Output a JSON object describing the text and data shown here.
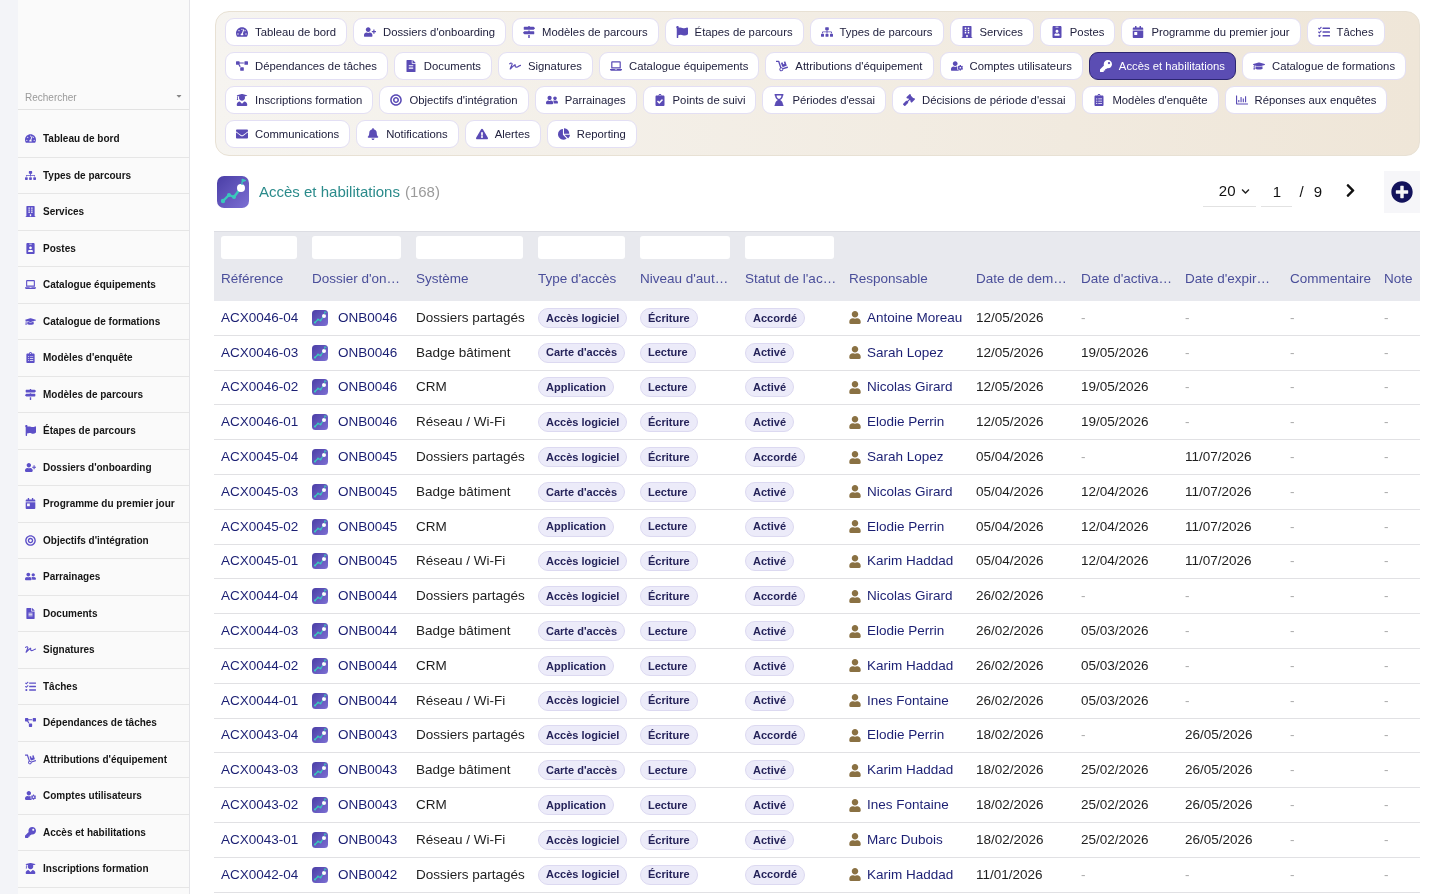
{
  "sidebar": {
    "search": {
      "placeholder": "Rechercher"
    },
    "items": [
      {
        "label": "Tableau de bord"
      },
      {
        "label": "Types de parcours"
      },
      {
        "label": "Services"
      },
      {
        "label": "Postes"
      },
      {
        "label": "Catalogue équipements"
      },
      {
        "label": "Catalogue de formations"
      },
      {
        "label": "Modèles d'enquête"
      },
      {
        "label": "Modèles de parcours"
      },
      {
        "label": "Étapes de parcours"
      },
      {
        "label": "Dossiers d'onboarding"
      },
      {
        "label": "Programme du premier jour"
      },
      {
        "label": "Objectifs d'intégration"
      },
      {
        "label": "Parrainages"
      },
      {
        "label": "Documents"
      },
      {
        "label": "Signatures"
      },
      {
        "label": "Tâches"
      },
      {
        "label": "Dépendances de tâches"
      },
      {
        "label": "Attributions d'équipement"
      },
      {
        "label": "Comptes utilisateurs"
      },
      {
        "label": "Accès et habilitations"
      },
      {
        "label": "Inscriptions formation"
      }
    ]
  },
  "nav_tabs": [
    {
      "label": "Tableau de bord",
      "selected": false
    },
    {
      "label": "Dossiers d'onboarding",
      "selected": false
    },
    {
      "label": "Modèles de parcours",
      "selected": false
    },
    {
      "label": "Étapes de parcours",
      "selected": false
    },
    {
      "label": "Types de parcours",
      "selected": false
    },
    {
      "label": "Services",
      "selected": false
    },
    {
      "label": "Postes",
      "selected": false
    },
    {
      "label": "Programme du premier jour",
      "selected": false
    },
    {
      "label": "Tâches",
      "selected": false
    },
    {
      "label": "Dépendances de tâches",
      "selected": false
    },
    {
      "label": "Documents",
      "selected": false
    },
    {
      "label": "Signatures",
      "selected": false
    },
    {
      "label": "Catalogue équipements",
      "selected": false
    },
    {
      "label": "Attributions d'équipement",
      "selected": false
    },
    {
      "label": "Comptes utilisateurs",
      "selected": false
    },
    {
      "label": "Accès et habilitations",
      "selected": true
    },
    {
      "label": "Catalogue de formations",
      "selected": false
    },
    {
      "label": "Inscriptions formation",
      "selected": false
    },
    {
      "label": "Objectifs d'intégration",
      "selected": false
    },
    {
      "label": "Parrainages",
      "selected": false
    },
    {
      "label": "Points de suivi",
      "selected": false
    },
    {
      "label": "Périodes d'essai",
      "selected": false
    },
    {
      "label": "Décisions de période d'essai",
      "selected": false
    },
    {
      "label": "Modèles d'enquête",
      "selected": false
    },
    {
      "label": "Réponses aux enquêtes",
      "selected": false
    },
    {
      "label": "Communications",
      "selected": false
    },
    {
      "label": "Notifications",
      "selected": false
    },
    {
      "label": "Alertes",
      "selected": false
    },
    {
      "label": "Reporting",
      "selected": false
    }
  ],
  "header": {
    "title": "Accès et habilitations",
    "count": "(168)"
  },
  "pagination": {
    "page_size": "20",
    "page": "1",
    "separator": "/",
    "total_pages": "9"
  },
  "table": {
    "columns": [
      {
        "label": "Référence",
        "kind": "link",
        "filter": true
      },
      {
        "label": "Dossier d'on…",
        "kind": "dossier",
        "filter": true
      },
      {
        "label": "Système",
        "kind": "text",
        "filter": true
      },
      {
        "label": "Type d'accès",
        "kind": "badge",
        "filter": true
      },
      {
        "label": "Niveau d'aut…",
        "kind": "badge",
        "filter": true
      },
      {
        "label": "Statut de l'ac…",
        "kind": "badge",
        "filter": true
      },
      {
        "label": "Responsable",
        "kind": "person",
        "filter": false
      },
      {
        "label": "Date de dem…",
        "kind": "text",
        "filter": false
      },
      {
        "label": "Date d'activa…",
        "kind": "text",
        "filter": false
      },
      {
        "label": "Date d'expir…",
        "kind": "text",
        "filter": false
      },
      {
        "label": "Commentaire",
        "kind": "text",
        "filter": false
      },
      {
        "label": "Note",
        "kind": "text",
        "filter": false
      }
    ],
    "rows": [
      {
        "cells": [
          "ACX0046-04",
          "ONB0046",
          "Dossiers partagés",
          "Accès logiciel",
          "Écriture",
          "Accordé",
          "Antoine Moreau",
          "12/05/2026",
          "-",
          "-",
          "-",
          "-"
        ],
        "muted": [
          false,
          false,
          false,
          false,
          false,
          false,
          false,
          false,
          true,
          true,
          true,
          true
        ]
      },
      {
        "cells": [
          "ACX0046-03",
          "ONB0046",
          "Badge bâtiment",
          "Carte d'accès",
          "Lecture",
          "Activé",
          "Sarah Lopez",
          "12/05/2026",
          "19/05/2026",
          "-",
          "-",
          "-"
        ],
        "muted": [
          false,
          false,
          false,
          false,
          false,
          false,
          false,
          false,
          false,
          true,
          true,
          true
        ]
      },
      {
        "cells": [
          "ACX0046-02",
          "ONB0046",
          "CRM",
          "Application",
          "Lecture",
          "Activé",
          "Nicolas Girard",
          "12/05/2026",
          "19/05/2026",
          "-",
          "-",
          "-"
        ],
        "muted": [
          false,
          false,
          false,
          false,
          false,
          false,
          false,
          false,
          false,
          true,
          true,
          true
        ]
      },
      {
        "cells": [
          "ACX0046-01",
          "ONB0046",
          "Réseau / Wi-Fi",
          "Accès logiciel",
          "Écriture",
          "Activé",
          "Elodie Perrin",
          "12/05/2026",
          "19/05/2026",
          "-",
          "-",
          "-"
        ],
        "muted": [
          false,
          false,
          false,
          false,
          false,
          false,
          false,
          false,
          false,
          true,
          true,
          true
        ]
      },
      {
        "cells": [
          "ACX0045-04",
          "ONB0045",
          "Dossiers partagés",
          "Accès logiciel",
          "Écriture",
          "Accordé",
          "Sarah Lopez",
          "05/04/2026",
          "-",
          "11/07/2026",
          "-",
          "-"
        ],
        "muted": [
          false,
          false,
          false,
          false,
          false,
          false,
          false,
          false,
          true,
          false,
          true,
          true
        ]
      },
      {
        "cells": [
          "ACX0045-03",
          "ONB0045",
          "Badge bâtiment",
          "Carte d'accès",
          "Lecture",
          "Activé",
          "Nicolas Girard",
          "05/04/2026",
          "12/04/2026",
          "11/07/2026",
          "-",
          "-"
        ],
        "muted": [
          false,
          false,
          false,
          false,
          false,
          false,
          false,
          false,
          false,
          false,
          true,
          true
        ]
      },
      {
        "cells": [
          "ACX0045-02",
          "ONB0045",
          "CRM",
          "Application",
          "Lecture",
          "Activé",
          "Elodie Perrin",
          "05/04/2026",
          "12/04/2026",
          "11/07/2026",
          "-",
          "-"
        ],
        "muted": [
          false,
          false,
          false,
          false,
          false,
          false,
          false,
          false,
          false,
          false,
          true,
          true
        ]
      },
      {
        "cells": [
          "ACX0045-01",
          "ONB0045",
          "Réseau / Wi-Fi",
          "Accès logiciel",
          "Écriture",
          "Activé",
          "Karim Haddad",
          "05/04/2026",
          "12/04/2026",
          "11/07/2026",
          "-",
          "-"
        ],
        "muted": [
          false,
          false,
          false,
          false,
          false,
          false,
          false,
          false,
          false,
          false,
          true,
          true
        ]
      },
      {
        "cells": [
          "ACX0044-04",
          "ONB0044",
          "Dossiers partagés",
          "Accès logiciel",
          "Écriture",
          "Accordé",
          "Nicolas Girard",
          "26/02/2026",
          "-",
          "-",
          "-",
          "-"
        ],
        "muted": [
          false,
          false,
          false,
          false,
          false,
          false,
          false,
          false,
          true,
          true,
          true,
          true
        ]
      },
      {
        "cells": [
          "ACX0044-03",
          "ONB0044",
          "Badge bâtiment",
          "Carte d'accès",
          "Lecture",
          "Activé",
          "Elodie Perrin",
          "26/02/2026",
          "05/03/2026",
          "-",
          "-",
          "-"
        ],
        "muted": [
          false,
          false,
          false,
          false,
          false,
          false,
          false,
          false,
          false,
          true,
          true,
          true
        ]
      },
      {
        "cells": [
          "ACX0044-02",
          "ONB0044",
          "CRM",
          "Application",
          "Lecture",
          "Activé",
          "Karim Haddad",
          "26/02/2026",
          "05/03/2026",
          "-",
          "-",
          "-"
        ],
        "muted": [
          false,
          false,
          false,
          false,
          false,
          false,
          false,
          false,
          false,
          true,
          true,
          true
        ]
      },
      {
        "cells": [
          "ACX0044-01",
          "ONB0044",
          "Réseau / Wi-Fi",
          "Accès logiciel",
          "Écriture",
          "Activé",
          "Ines Fontaine",
          "26/02/2026",
          "05/03/2026",
          "-",
          "-",
          "-"
        ],
        "muted": [
          false,
          false,
          false,
          false,
          false,
          false,
          false,
          false,
          false,
          true,
          true,
          true
        ]
      },
      {
        "cells": [
          "ACX0043-04",
          "ONB0043",
          "Dossiers partagés",
          "Accès logiciel",
          "Écriture",
          "Accordé",
          "Elodie Perrin",
          "18/02/2026",
          "-",
          "26/05/2026",
          "-",
          "-"
        ],
        "muted": [
          false,
          false,
          false,
          false,
          false,
          false,
          false,
          false,
          true,
          false,
          true,
          true
        ]
      },
      {
        "cells": [
          "ACX0043-03",
          "ONB0043",
          "Badge bâtiment",
          "Carte d'accès",
          "Lecture",
          "Activé",
          "Karim Haddad",
          "18/02/2026",
          "25/02/2026",
          "26/05/2026",
          "-",
          "-"
        ],
        "muted": [
          false,
          false,
          false,
          false,
          false,
          false,
          false,
          false,
          false,
          false,
          true,
          true
        ]
      },
      {
        "cells": [
          "ACX0043-02",
          "ONB0043",
          "CRM",
          "Application",
          "Lecture",
          "Activé",
          "Ines Fontaine",
          "18/02/2026",
          "25/02/2026",
          "26/05/2026",
          "-",
          "-"
        ],
        "muted": [
          false,
          false,
          false,
          false,
          false,
          false,
          false,
          false,
          false,
          false,
          true,
          true
        ]
      },
      {
        "cells": [
          "ACX0043-01",
          "ONB0043",
          "Réseau / Wi-Fi",
          "Accès logiciel",
          "Écriture",
          "Activé",
          "Marc Dubois",
          "18/02/2026",
          "25/02/2026",
          "26/05/2026",
          "-",
          "-"
        ],
        "muted": [
          false,
          false,
          false,
          false,
          false,
          false,
          false,
          false,
          false,
          false,
          true,
          true
        ]
      },
      {
        "cells": [
          "ACX0042-04",
          "ONB0042",
          "Dossiers partagés",
          "Accès logiciel",
          "Écriture",
          "Accordé",
          "Karim Haddad",
          "11/01/2026",
          "-",
          "-",
          "-",
          "-"
        ],
        "muted": [
          false,
          false,
          false,
          false,
          false,
          false,
          false,
          false,
          true,
          true,
          true,
          true
        ]
      }
    ]
  }
}
